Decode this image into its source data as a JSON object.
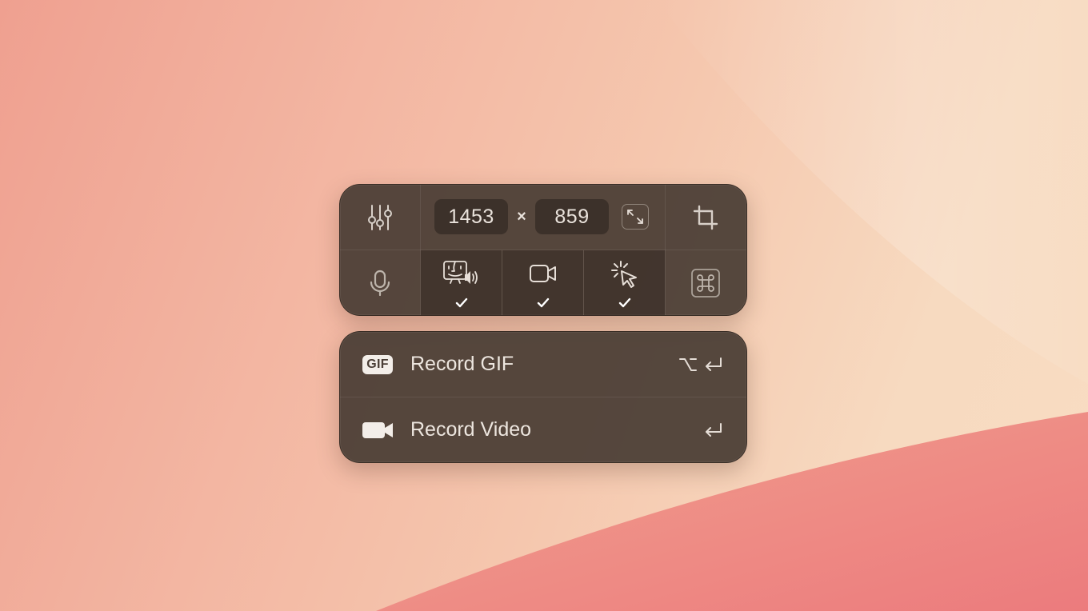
{
  "toolbar": {
    "width_value": "1453",
    "height_value": "859",
    "times_symbol": "×",
    "icons": {
      "settings": "sliders-icon",
      "resize": "expand-arrows-icon",
      "crop": "crop-icon",
      "microphone": "microphone-icon",
      "system_audio": "finder-with-speaker-icon",
      "camera": "video-camera-icon",
      "clicks": "cursor-click-icon",
      "keystrokes": "command-key-icon",
      "checkmark": "checkmark-icon"
    },
    "toggles": {
      "system_audio": true,
      "camera": true,
      "clicks": true
    }
  },
  "actions": {
    "record_gif": {
      "badge": "GIF",
      "label": "Record GIF",
      "shortcut": "⌥ ↩"
    },
    "record_video": {
      "label": "Record Video",
      "shortcut": "↩"
    }
  },
  "colors": {
    "panel_bg": "#4a3e36",
    "text": "#ede6df",
    "wallpaper_left": "#efa090",
    "wallpaper_right": "#f8dcc2",
    "wallpaper_wave": "#ee7f7e"
  }
}
